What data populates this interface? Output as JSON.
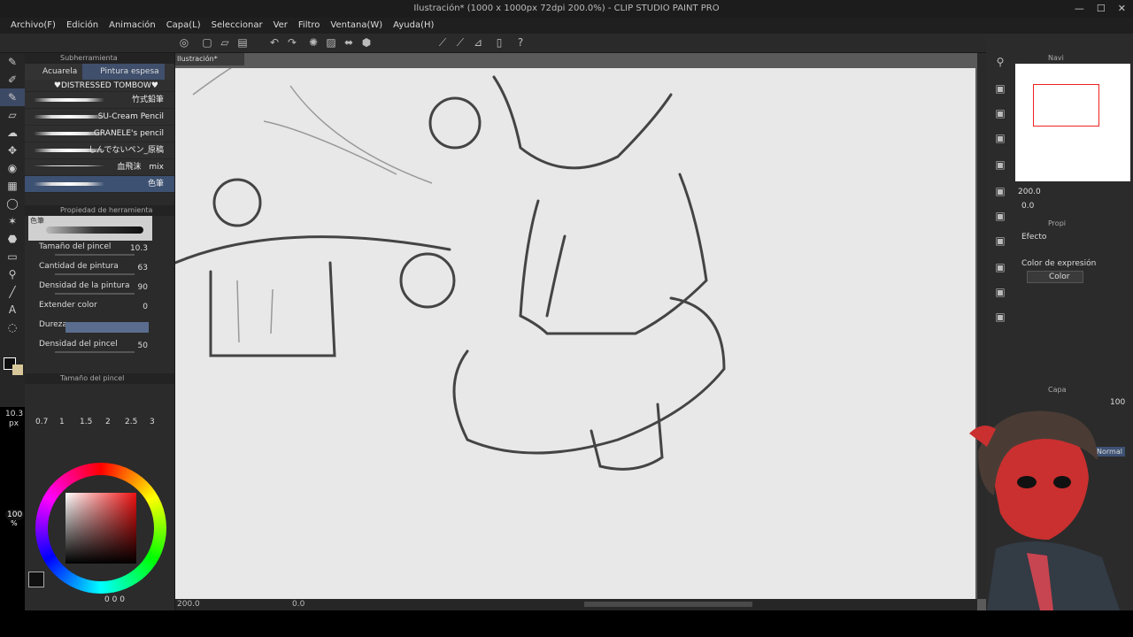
{
  "window": {
    "title": "Ilustración* (1000 x 1000px 72dpi 200.0%) - CLIP STUDIO PAINT PRO",
    "min": "—",
    "max": "☐",
    "close": "✕"
  },
  "menu": [
    "Archivo(F)",
    "Edición",
    "Animación",
    "Capa(L)",
    "Seleccionar",
    "Ver",
    "Filtro",
    "Ventana(W)",
    "Ayuda(H)"
  ],
  "subtool": {
    "header": "Subherramienta",
    "tabs": [
      "Acuarela",
      "Pintura espesa"
    ],
    "brushes": [
      "♥DISTRESSED TOMBOW♥",
      "竹式鉛筆",
      "SU-Cream Pencil",
      "GRANELE's pencil",
      "しんでないペン_原稿",
      "血飛沫　mix",
      "色筆"
    ]
  },
  "toolprop": {
    "header": "Propiedad de herramienta",
    "name": "色筆",
    "props": [
      {
        "label": "Tamaño del pincel",
        "value": "10.3"
      },
      {
        "label": "Cantidad de pintura",
        "value": "63"
      },
      {
        "label": "Densidad de la pintura",
        "value": "90"
      },
      {
        "label": "Extender color",
        "value": "0"
      },
      {
        "label": "Dureza",
        "value": ""
      },
      {
        "label": "Densidad del pincel",
        "value": "50"
      }
    ]
  },
  "brushsize": {
    "header": "Tamaño del pincel",
    "current": "10.3",
    "unit": "px",
    "sizes": [
      "0.7",
      "1",
      "1.5",
      "2",
      "2.5",
      "3"
    ]
  },
  "color": {
    "opacity": "100",
    "pct": "%",
    "r": "0",
    "g": "0",
    "b": "0",
    "main": "#101010",
    "sub": "#d8c79a"
  },
  "canvas": {
    "tab": "Ilustración*",
    "zoom": "200.0",
    "rotate": "0.0"
  },
  "navigator": {
    "label": "Navi",
    "zoom": "200.0",
    "rotate": "0.0"
  },
  "layerprop": {
    "header": "Propi",
    "effect": "Efecto",
    "expr_label": "Color de expresión",
    "expr_value": "Color"
  },
  "layer": {
    "header": "Capa",
    "opacity": "100",
    "blend": "Normal"
  },
  "colors": {
    "accent": "#3d5172",
    "canvas": "#e8e8e8",
    "nav_rect": "#e22"
  }
}
